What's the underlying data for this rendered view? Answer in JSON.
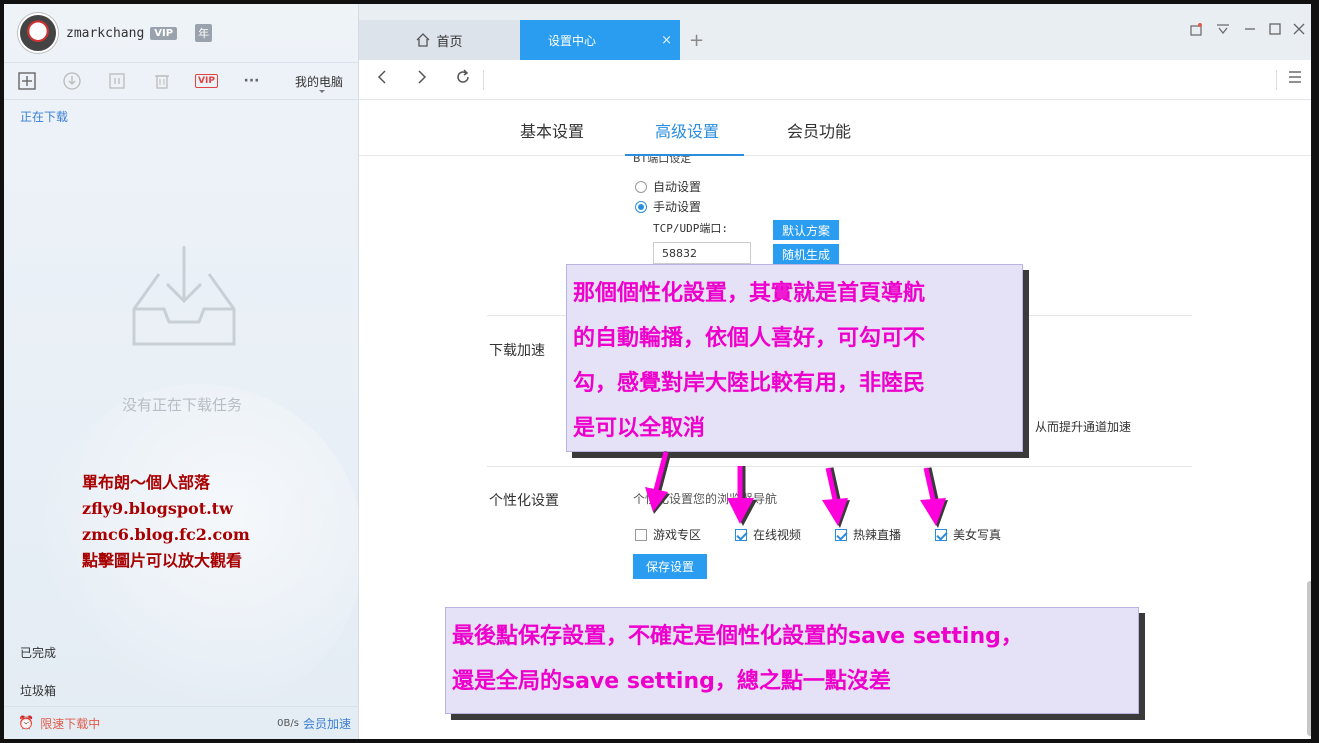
{
  "user": {
    "name": "zmarkchang",
    "vip": "VIP",
    "year": "年"
  },
  "toolbar": {
    "vip": "VIP",
    "more": "···",
    "my_pc": "我的电脑"
  },
  "sidebar": {
    "downloading": "正在下载",
    "empty": "没有正在下载任务",
    "completed": "已完成",
    "trash": "垃圾箱",
    "limit": "限速下载中",
    "speed": "0B/s",
    "accel": "会员加速"
  },
  "blog_note": [
    "單布朗～個人部落",
    "zfly9.blogspot.tw",
    "zmc6.blog.fc2.com",
    "點擊圖片可以放大觀看"
  ],
  "tabs": {
    "home": "首页",
    "settings": "设置中心",
    "close": "×",
    "add": "+"
  },
  "settings_tabs": [
    "基本设置",
    "高级设置",
    "会员功能"
  ],
  "bt": {
    "title": "BT端口设定",
    "auto": "自动设置",
    "manual": "手动设置",
    "port_label": "TCP/UDP端口:",
    "port_value": "58832",
    "default_btn": "默认方案",
    "random_btn": "随机生成"
  },
  "accel_section": {
    "label": "下载加速",
    "text": "从而提升通道加速"
  },
  "personal": {
    "label": "个性化设置",
    "desc": "个性化设置您的浏览器导航",
    "options": [
      {
        "label": "游戏专区",
        "checked": false
      },
      {
        "label": "在线视频",
        "checked": true
      },
      {
        "label": "热辣直播",
        "checked": true
      },
      {
        "label": "美女写真",
        "checked": true
      }
    ],
    "save": "保存设置"
  },
  "callout1": [
    "那個個性化設置，其實就是首頁導航",
    "的自動輪播，依個人喜好，可勾可不",
    "勾，感覺對岸大陸比較有用，非陸民",
    "是可以全取消"
  ],
  "callout2": [
    "最後點保存設置，不確定是個性化設置的save setting，",
    "還是全局的save setting，總之點一點沒差"
  ],
  "colors": {
    "accent": "#2a9df0",
    "callout_text": "#ee00cc",
    "callout_bg": "#e5e2f8",
    "blog_note": "#a80000"
  }
}
